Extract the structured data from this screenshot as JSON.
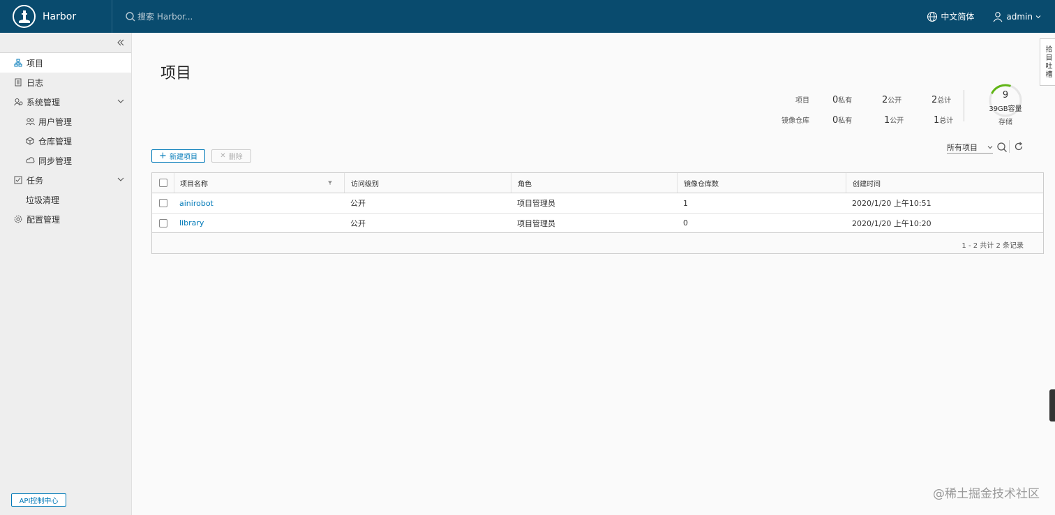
{
  "header": {
    "brand": "Harbor",
    "search_placeholder": "搜索 Harbor...",
    "language": "中文简体",
    "user": "admin"
  },
  "sidebar": {
    "items": [
      {
        "label": "项目",
        "icon": "project-icon",
        "active": true
      },
      {
        "label": "日志",
        "icon": "log-icon"
      },
      {
        "label": "系统管理",
        "icon": "admin-icon",
        "expandable": true
      },
      {
        "label": "用户管理",
        "icon": "users-icon",
        "sub": true
      },
      {
        "label": "仓库管理",
        "icon": "registry-icon",
        "sub": true
      },
      {
        "label": "同步管理",
        "icon": "replication-icon",
        "sub": true
      },
      {
        "label": "任务",
        "icon": "tasks-icon",
        "expandable": true
      },
      {
        "label": "垃圾清理",
        "sub": true
      },
      {
        "label": "配置管理",
        "icon": "config-icon"
      }
    ],
    "api_button": "API控制中心"
  },
  "main": {
    "title": "项目",
    "stats": {
      "projects_label": "项目",
      "repos_label": "镜像仓库",
      "private_suffix": "私有",
      "public_suffix": "公开",
      "total_suffix": "总计",
      "projects_private": "0",
      "projects_public": "2",
      "projects_total": "2",
      "repos_private": "0",
      "repos_public": "1",
      "repos_total": "1"
    },
    "storage": {
      "value": "9",
      "capacity": "39GB容量",
      "label": "存储",
      "used_fraction": 0.23,
      "color": "#60b515"
    },
    "buttons": {
      "new_project": "新建项目",
      "delete": "删除"
    },
    "filter": {
      "selected": "所有项目"
    },
    "table": {
      "columns": [
        "项目名称",
        "访问级别",
        "角色",
        "镜像仓库数",
        "创建时间"
      ],
      "rows": [
        {
          "name": "ainirobot",
          "access": "公开",
          "role": "项目管理员",
          "repos": "1",
          "created": "2020/1/20 上午10:51"
        },
        {
          "name": "library",
          "access": "公开",
          "role": "项目管理员",
          "repos": "0",
          "created": "2020/1/20 上午10:20"
        }
      ],
      "footer": "1 - 2 共计 2 条记录"
    }
  },
  "side_tab": "拾目吐槽",
  "watermark": "@稀土掘金技术社区"
}
